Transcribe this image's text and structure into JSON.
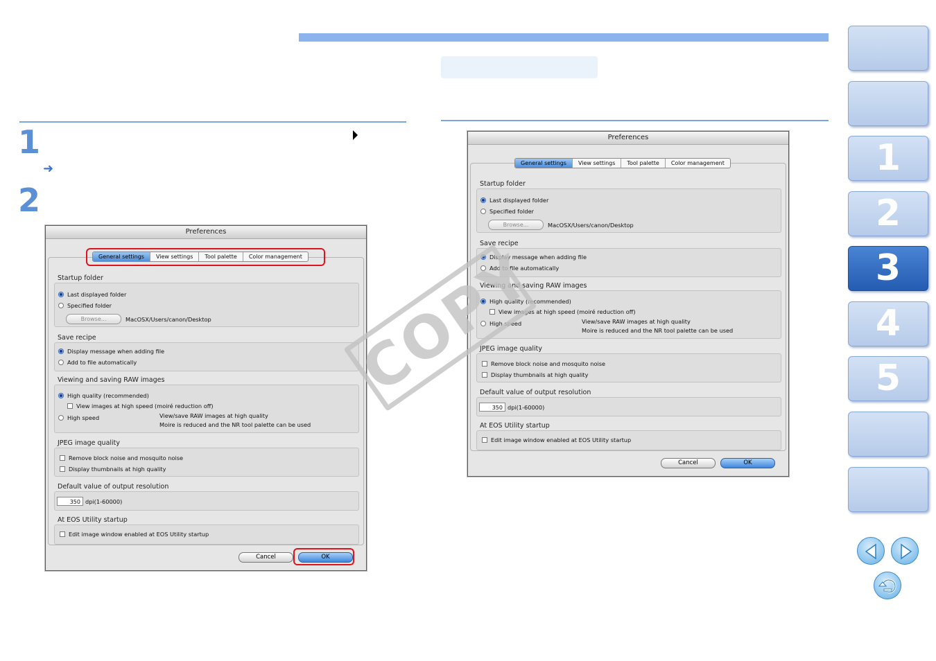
{
  "steps": {
    "step1": "1",
    "step2": "2",
    "sub_arrow": "➜"
  },
  "nav": {
    "chapters": [
      "",
      "",
      "1",
      "2",
      "3",
      "4",
      "5",
      "",
      ""
    ],
    "active_index": 4
  },
  "watermark": "COPY",
  "dialog": {
    "title": "Preferences",
    "tabs": [
      "General settings",
      "View settings",
      "Tool palette",
      "Color management"
    ],
    "startup_folder": {
      "title": "Startup folder",
      "last_displayed": "Last displayed folder",
      "specified": "Specified folder",
      "browse": "Browse...",
      "path": "MacOSX/Users/canon/Desktop"
    },
    "save_recipe": {
      "title": "Save recipe",
      "display_message": "Display message when adding file",
      "add_auto": "Add to file automatically"
    },
    "raw": {
      "title": "Viewing and saving RAW images",
      "high_quality": "High quality (recommended)",
      "view_high_speed": "View images at high speed (moiré reduction off)",
      "high_speed": "High speed",
      "note1": "View/save RAW images at high quality",
      "note2": "Moire is reduced and the NR tool palette can be used"
    },
    "jpeg": {
      "title": "JPEG image quality",
      "remove_noise": "Remove block noise and mosquito noise",
      "thumbs": "Display thumbnails at high quality"
    },
    "resolution": {
      "title": "Default value of output resolution",
      "value": "350",
      "unit": "dpi(1-60000)"
    },
    "eos": {
      "title": "At EOS Utility startup",
      "edit_window": "Edit image window enabled at EOS Utility startup"
    },
    "buttons": {
      "cancel": "Cancel",
      "ok": "OK"
    }
  },
  "colors": {
    "accent": "#5b8fd6",
    "highlight": "#e0121b",
    "nav_active": "#245cb2"
  }
}
